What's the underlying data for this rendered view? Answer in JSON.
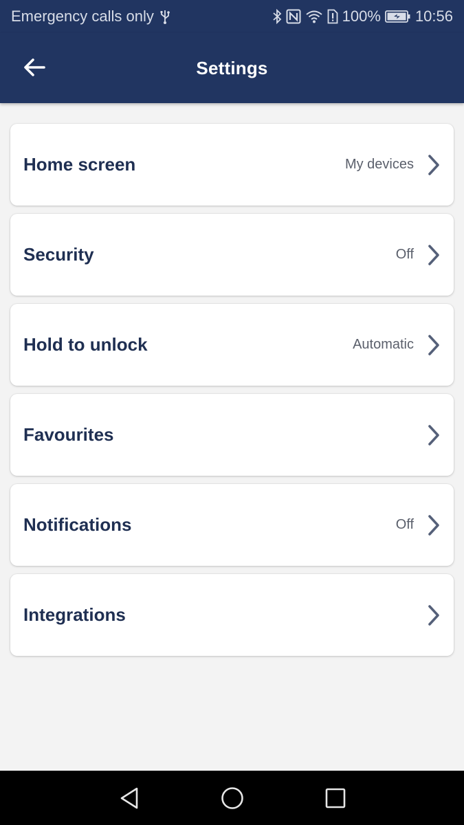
{
  "status_bar": {
    "carrier_text": "Emergency calls only",
    "battery_percent": "100%",
    "time": "10:56",
    "icons": [
      "usb-icon",
      "bluetooth-icon",
      "nfc-icon",
      "wifi-icon",
      "sim-alert-icon",
      "battery-icon"
    ]
  },
  "app_bar": {
    "title": "Settings",
    "back_icon": "arrow-left-icon"
  },
  "settings": {
    "items": [
      {
        "label": "Home screen",
        "value": "My devices"
      },
      {
        "label": "Security",
        "value": "Off"
      },
      {
        "label": "Hold to unlock",
        "value": "Automatic"
      },
      {
        "label": "Favourites",
        "value": ""
      },
      {
        "label": "Notifications",
        "value": "Off"
      },
      {
        "label": "Integrations",
        "value": ""
      }
    ]
  },
  "nav_bar": {
    "buttons": [
      "back-triangle-icon",
      "home-circle-icon",
      "recents-square-icon"
    ]
  },
  "colors": {
    "header_bg": "#213561",
    "page_bg": "#f3f3f3",
    "card_bg": "#ffffff",
    "label_text": "#1f2f52",
    "value_text": "#5a5f6b",
    "chevron": "#556079"
  }
}
